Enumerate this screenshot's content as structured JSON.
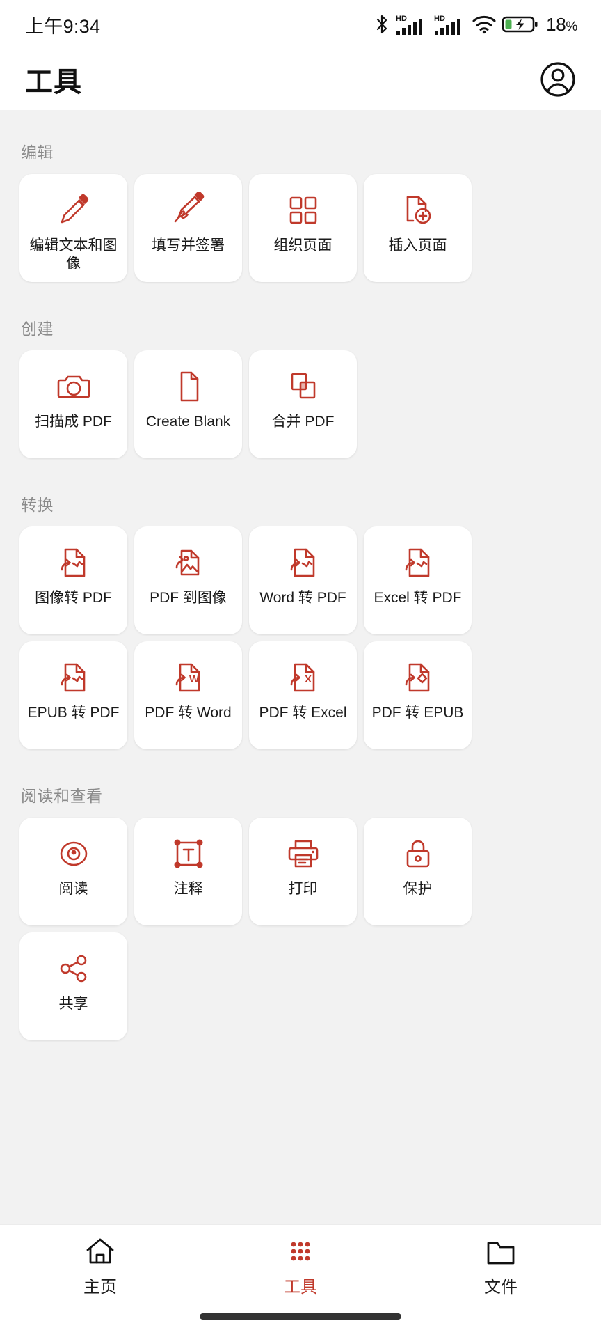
{
  "status_bar": {
    "time": "上午9:34",
    "battery_percent": "18",
    "percent_symbol": "%",
    "icons": [
      "bluetooth-icon",
      "hd-signal-icon",
      "hd-signal-icon-2",
      "wifi-icon",
      "battery-charging-icon"
    ]
  },
  "header": {
    "title": "工具",
    "avatar_icon": "account-circle-icon"
  },
  "colors": {
    "accent": "#c0392b",
    "icon_red": "#c0392b",
    "background": "#f2f2f2",
    "card": "#ffffff",
    "section_title": "#8a8a8a",
    "battery_green": "#4caf50"
  },
  "sections": [
    {
      "title": "编辑",
      "items": [
        {
          "label": "编辑文本和图像",
          "icon": "pencil-icon"
        },
        {
          "label": "填写并签署",
          "icon": "pen-signature-icon"
        },
        {
          "label": "组织页面",
          "icon": "grid-pages-icon"
        },
        {
          "label": "插入页面",
          "icon": "page-add-icon"
        }
      ]
    },
    {
      "title": "创建",
      "items": [
        {
          "label": "扫描成 PDF",
          "icon": "camera-icon"
        },
        {
          "label": "Create Blank",
          "icon": "blank-page-icon"
        },
        {
          "label": "合并 PDF",
          "icon": "merge-icon"
        }
      ]
    },
    {
      "title": "转换",
      "items": [
        {
          "label": "图像转 PDF",
          "icon": "convert-to-pdf-icon"
        },
        {
          "label": "PDF 到图像",
          "icon": "pdf-to-image-icon"
        },
        {
          "label": "Word 转 PDF",
          "icon": "convert-to-pdf-icon"
        },
        {
          "label": "Excel 转 PDF",
          "icon": "convert-to-pdf-icon"
        },
        {
          "label": "EPUB 转 PDF",
          "icon": "convert-to-pdf-icon"
        },
        {
          "label": "PDF 转 Word",
          "icon": "pdf-to-word-icon"
        },
        {
          "label": "PDF 转 Excel",
          "icon": "pdf-to-excel-icon"
        },
        {
          "label": "PDF 转 EPUB",
          "icon": "pdf-to-epub-icon"
        }
      ]
    },
    {
      "title": "阅读和查看",
      "items": [
        {
          "label": "阅读",
          "icon": "eye-icon"
        },
        {
          "label": "注释",
          "icon": "text-annotation-icon"
        },
        {
          "label": "打印",
          "icon": "printer-icon"
        },
        {
          "label": "保护",
          "icon": "lock-icon"
        },
        {
          "label": "共享",
          "icon": "share-icon"
        }
      ]
    }
  ],
  "bottom_nav": {
    "items": [
      {
        "label": "主页",
        "icon": "home-icon",
        "active": false
      },
      {
        "label": "工具",
        "icon": "apps-grid-icon",
        "active": true
      },
      {
        "label": "文件",
        "icon": "folder-icon",
        "active": false
      }
    ]
  }
}
